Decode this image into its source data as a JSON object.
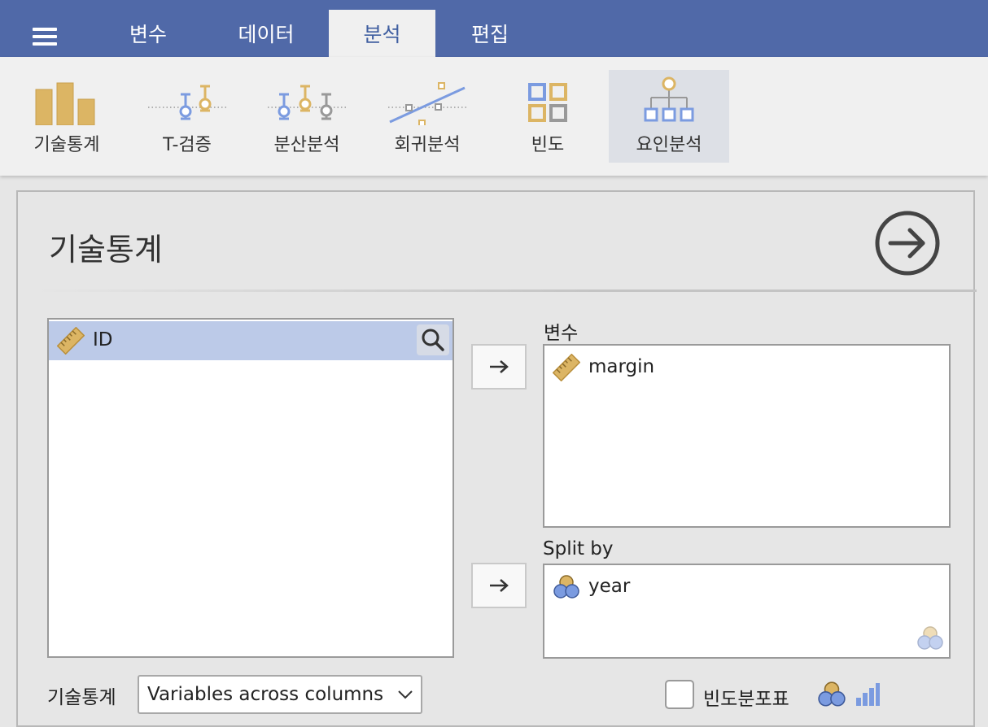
{
  "topbar": {
    "menu_icon": "hamburger-icon",
    "tabs": [
      {
        "label": "변수"
      },
      {
        "label": "데이터"
      },
      {
        "label": "분석",
        "active": true
      },
      {
        "label": "편집"
      }
    ]
  },
  "ribbon": {
    "items": [
      {
        "label": "기술통계",
        "icon": "bar-chart-icon"
      },
      {
        "label": "T-검증",
        "icon": "t-test-icon"
      },
      {
        "label": "분산분석",
        "icon": "anova-icon"
      },
      {
        "label": "회귀분석",
        "icon": "regression-icon"
      },
      {
        "label": "빈도",
        "icon": "frequencies-icon"
      },
      {
        "label": "요인분석",
        "icon": "factor-icon",
        "selected": true
      }
    ]
  },
  "panel": {
    "title": "기술통계",
    "run_icon": "arrow-right-circle-icon",
    "source_list": [
      {
        "name": "ID",
        "type": "continuous",
        "selected": true
      }
    ],
    "variables_label": "변수",
    "variables": [
      {
        "name": "margin",
        "type": "continuous"
      }
    ],
    "split_label": "Split by",
    "split": [
      {
        "name": "year",
        "type": "nominal"
      }
    ],
    "descriptives_label": "기술통계",
    "descriptives_value": "Variables across columns",
    "freq_label": "빈도분포표",
    "freq_checked": false
  },
  "colors": {
    "topbar": "#5069a8",
    "ribbon_selected": "#dde0e6",
    "row_selected": "#bccae8",
    "gold": "#dcb564",
    "blue": "#7b9be0"
  }
}
